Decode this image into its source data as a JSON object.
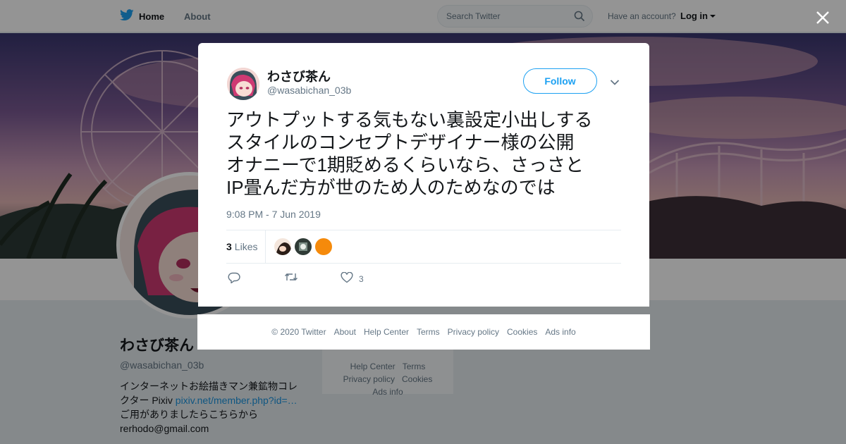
{
  "nav": {
    "home_label": "Home",
    "about_label": "About",
    "search_placeholder": "Search Twitter",
    "account_prompt": "Have an account?",
    "login_label": "Log in"
  },
  "profile": {
    "name": "わさび茶ん",
    "handle": "@wasabichan_03b",
    "bio_line1": "インターネットお絵描きマン兼鉱物コレ",
    "bio_line2_prefix": "クター Pixiv ",
    "bio_link": "pixiv.net/member.php?id=…",
    "bio_line3": "ご用がありましたらこちらから",
    "bio_line4": "rerhodo@gmail.com"
  },
  "sidebar_footer": {
    "help": "Help Center",
    "terms": "Terms",
    "privacy": "Privacy policy",
    "cookies": "Cookies",
    "ads": "Ads info"
  },
  "tweet": {
    "author_name": "わさび茶ん",
    "author_handle": "@wasabichan_03b",
    "follow_label": "Follow",
    "text_lines": [
      "アウトプットする気もない裏設定小出しする",
      "スタイルのコンセプトデザイナー様の公開",
      "オナニーで1期貶めるくらいなら、さっさと",
      "IP畳んだ方が世のため人のためなのでは"
    ],
    "timestamp": "9:08 PM - 7 Jun 2019",
    "likes_count": "3",
    "likes_label": "Likes",
    "like_action_count": "3"
  },
  "footer": {
    "copyright": "© 2020 Twitter",
    "about": "About",
    "help": "Help Center",
    "terms": "Terms",
    "privacy": "Privacy policy",
    "cookies": "Cookies",
    "ads": "Ads info"
  },
  "colors": {
    "brand": "#1da1f2",
    "text": "#14171a",
    "muted": "#657786",
    "border": "#e6ecf0"
  },
  "icons": [
    "twitter-bird-icon",
    "search-icon",
    "close-icon",
    "chevron-down-icon",
    "reply-icon",
    "retweet-icon",
    "heart-icon"
  ]
}
